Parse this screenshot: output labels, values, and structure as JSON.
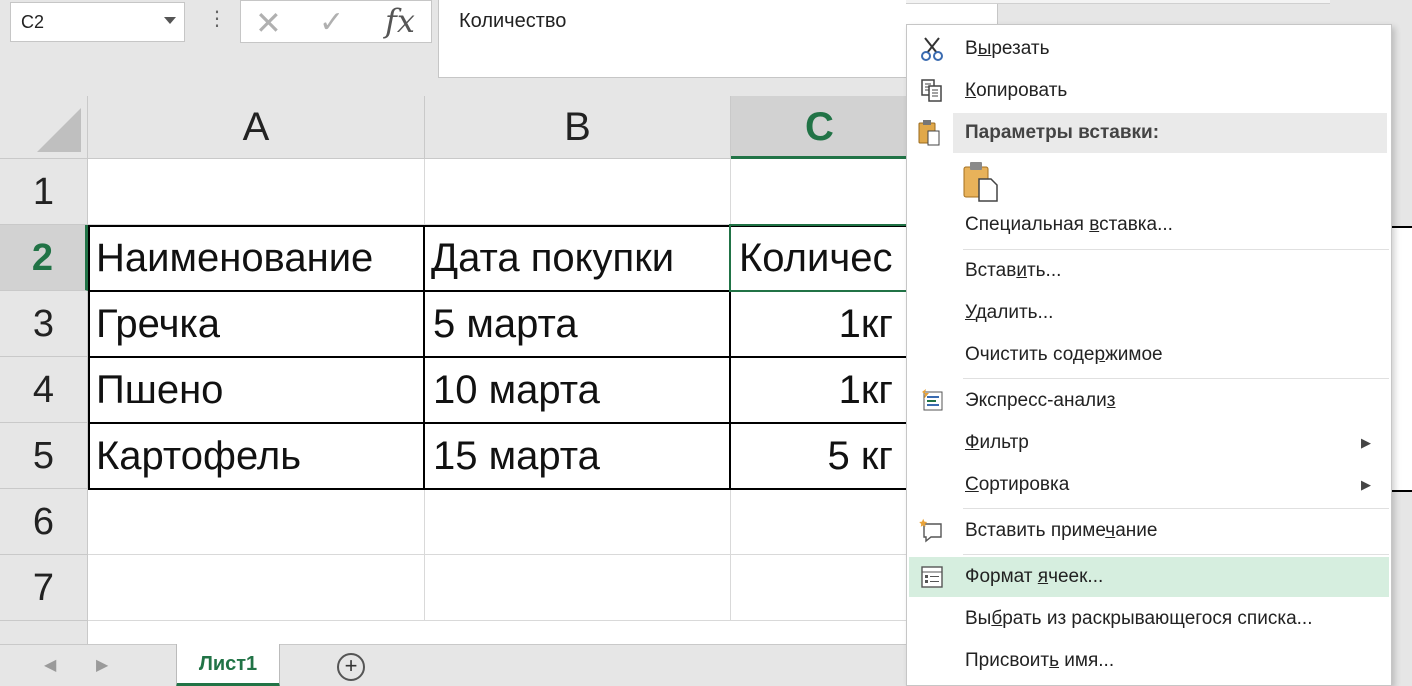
{
  "formula_bar": {
    "name_box": "C2",
    "formula": "Количество"
  },
  "columns": [
    "A",
    "B",
    "C"
  ],
  "active_column": "C",
  "rows": [
    "1",
    "2",
    "3",
    "4",
    "5",
    "6",
    "7"
  ],
  "active_row": "2",
  "cells": {
    "A2": "Наименование",
    "B2": "Дата покупки",
    "C2": "Количес",
    "A3": "Гречка",
    "B3": "5 марта",
    "C3": "1кг",
    "A4": "Пшено",
    "B4": "10 марта",
    "C4": "1кг",
    "A5": "Картофель",
    "B5": "15 марта",
    "C5": "5 кг"
  },
  "sheet_tabs": {
    "active": "Лист1"
  },
  "context_menu": {
    "cut": {
      "pre": "В",
      "u": "ы",
      "post": "резать"
    },
    "copy": {
      "pre": "",
      "u": "К",
      "post": "опировать"
    },
    "paste_options": "Параметры вставки:",
    "paste_special": {
      "pre": "Специальная ",
      "u": "в",
      "post": "ставка..."
    },
    "insert": {
      "pre": "Встав",
      "u": "и",
      "post": "ть..."
    },
    "delete": {
      "pre": "",
      "u": "У",
      "post": "далить..."
    },
    "clear": {
      "pre": "Очистить соде",
      "u": "р",
      "post": "жимое"
    },
    "quick_analysis": {
      "pre": "Экспресс-анали",
      "u": "з",
      "post": ""
    },
    "filter": {
      "pre": "",
      "u": "Ф",
      "post": "ильтр"
    },
    "sort": {
      "pre": "",
      "u": "С",
      "post": "ортировка"
    },
    "insert_comment": {
      "pre": "Вставить приме",
      "u": "ч",
      "post": "ание"
    },
    "format_cells": {
      "pre": "Формат ",
      "u": "я",
      "post": "чеек..."
    },
    "pick_list": {
      "pre": "Вы",
      "u": "б",
      "post": "рать из раскрывающегося списка..."
    },
    "define_name": {
      "pre": "Присвоит",
      "u": "ь",
      "post": " имя..."
    }
  },
  "colors": {
    "excel_green": "#217346",
    "highlight": "#d6eedf"
  }
}
